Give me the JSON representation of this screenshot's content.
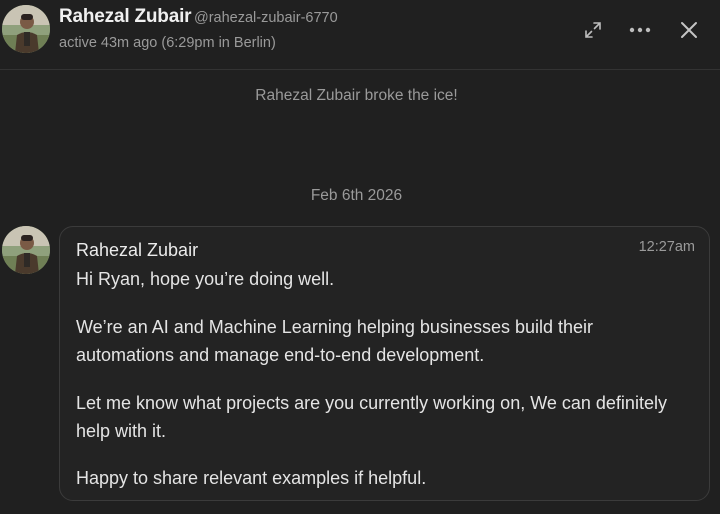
{
  "header": {
    "name": "Rahezal Zubair",
    "handle": "@rahezal-zubair-6770",
    "status": "active 43m ago (6:29pm in Berlin)",
    "icons": {
      "expand": "expand-icon",
      "more": "more-icon",
      "close": "close-icon"
    }
  },
  "system": {
    "event": "Rahezal Zubair broke the ice!",
    "date_separator": "Feb 6th 2026"
  },
  "message": {
    "sender": "Rahezal Zubair",
    "time": "12:27am",
    "paragraphs": [
      "Hi Ryan, hope you’re doing well.",
      "We’re an AI and Machine Learning helping businesses build their automations and manage end-to-end development.",
      "Let me know what projects are you currently working on, We can definitely help with it.",
      "Happy to share relevant examples if helpful."
    ]
  },
  "colors": {
    "background": "#202020",
    "bubble_border": "#3b3b3b",
    "muted_text": "#9a9a9a",
    "primary_text": "#e4e4e4"
  }
}
